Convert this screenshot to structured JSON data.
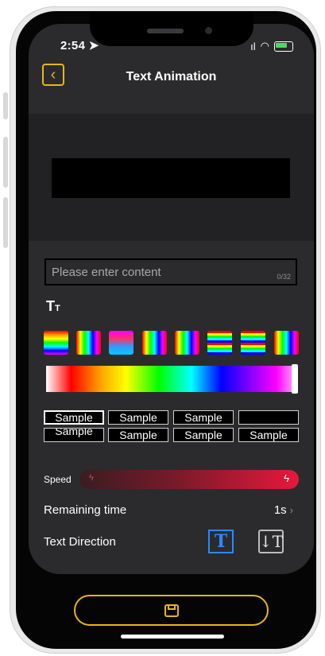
{
  "status": {
    "time": "2:54",
    "signal_icon": "signal-bars-icon",
    "wifi_icon": "wifi-icon",
    "battery_icon": "battery-charging-icon"
  },
  "header": {
    "title": "Text Animation",
    "back_icon": "chevron-left-icon"
  },
  "input": {
    "placeholder": "Please enter content",
    "counter": "0/32"
  },
  "font_icon": {
    "label": "T",
    "small": "T"
  },
  "gradient_swatches": [
    "rainbow-horizontal",
    "rainbow-vertical",
    "pink-blue",
    "rainbow-vertical",
    "rainbow-vertical",
    "rainbow-stripes",
    "rainbow-stripes",
    "rainbow-vertical"
  ],
  "samples": {
    "row1": [
      "Sample",
      "Sample",
      "Sample",
      ""
    ],
    "row2": [
      "Sample",
      "Sample",
      "Sample",
      "Sample"
    ]
  },
  "speed": {
    "label": "Speed",
    "level": 1.0,
    "accent": "#e8183c"
  },
  "remaining_time": {
    "label": "Remaining time",
    "value": "1s"
  },
  "text_direction": {
    "label": "Text Direction",
    "selected": "horizontal"
  },
  "colors": {
    "accent": "#e8b70e",
    "selected_blue": "#2e87ff",
    "background": "#2b2b2d"
  }
}
